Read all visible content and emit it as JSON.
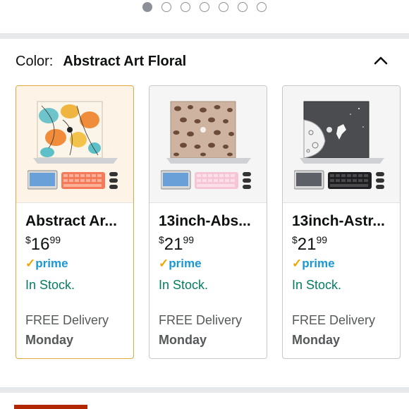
{
  "carousel": {
    "dot_count": 7,
    "active_index": 0
  },
  "variation": {
    "label": "Color:",
    "value": "Abstract Art Floral",
    "icon": "chevron-up-icon"
  },
  "products": [
    {
      "title": "Abstract Ar...",
      "price_symbol": "$",
      "price_whole": "16",
      "price_cents": "99",
      "prime_check": "✓",
      "prime_text": "prime",
      "stock": "In Stock.",
      "delivery": "FREE Delivery",
      "delivery_day": "Monday",
      "selected": true,
      "pattern": "floral"
    },
    {
      "title": "13inch-Abs...",
      "price_symbol": "$",
      "price_whole": "21",
      "price_cents": "99",
      "prime_check": "✓",
      "prime_text": "prime",
      "stock": "In Stock.",
      "delivery": "FREE Delivery",
      "delivery_day": "Monday",
      "selected": false,
      "pattern": "leopard"
    },
    {
      "title": "13inch-Astr...",
      "price_symbol": "$",
      "price_whole": "21",
      "price_cents": "99",
      "prime_check": "✓",
      "prime_text": "prime",
      "stock": "In Stock.",
      "delivery": "FREE Delivery",
      "delivery_day": "Monday",
      "selected": false,
      "pattern": "astronaut"
    }
  ],
  "colors": {
    "selected_border": "#e0a83e",
    "prime": "#1a98d5",
    "in_stock": "#067d62",
    "cta": "#b12704"
  }
}
